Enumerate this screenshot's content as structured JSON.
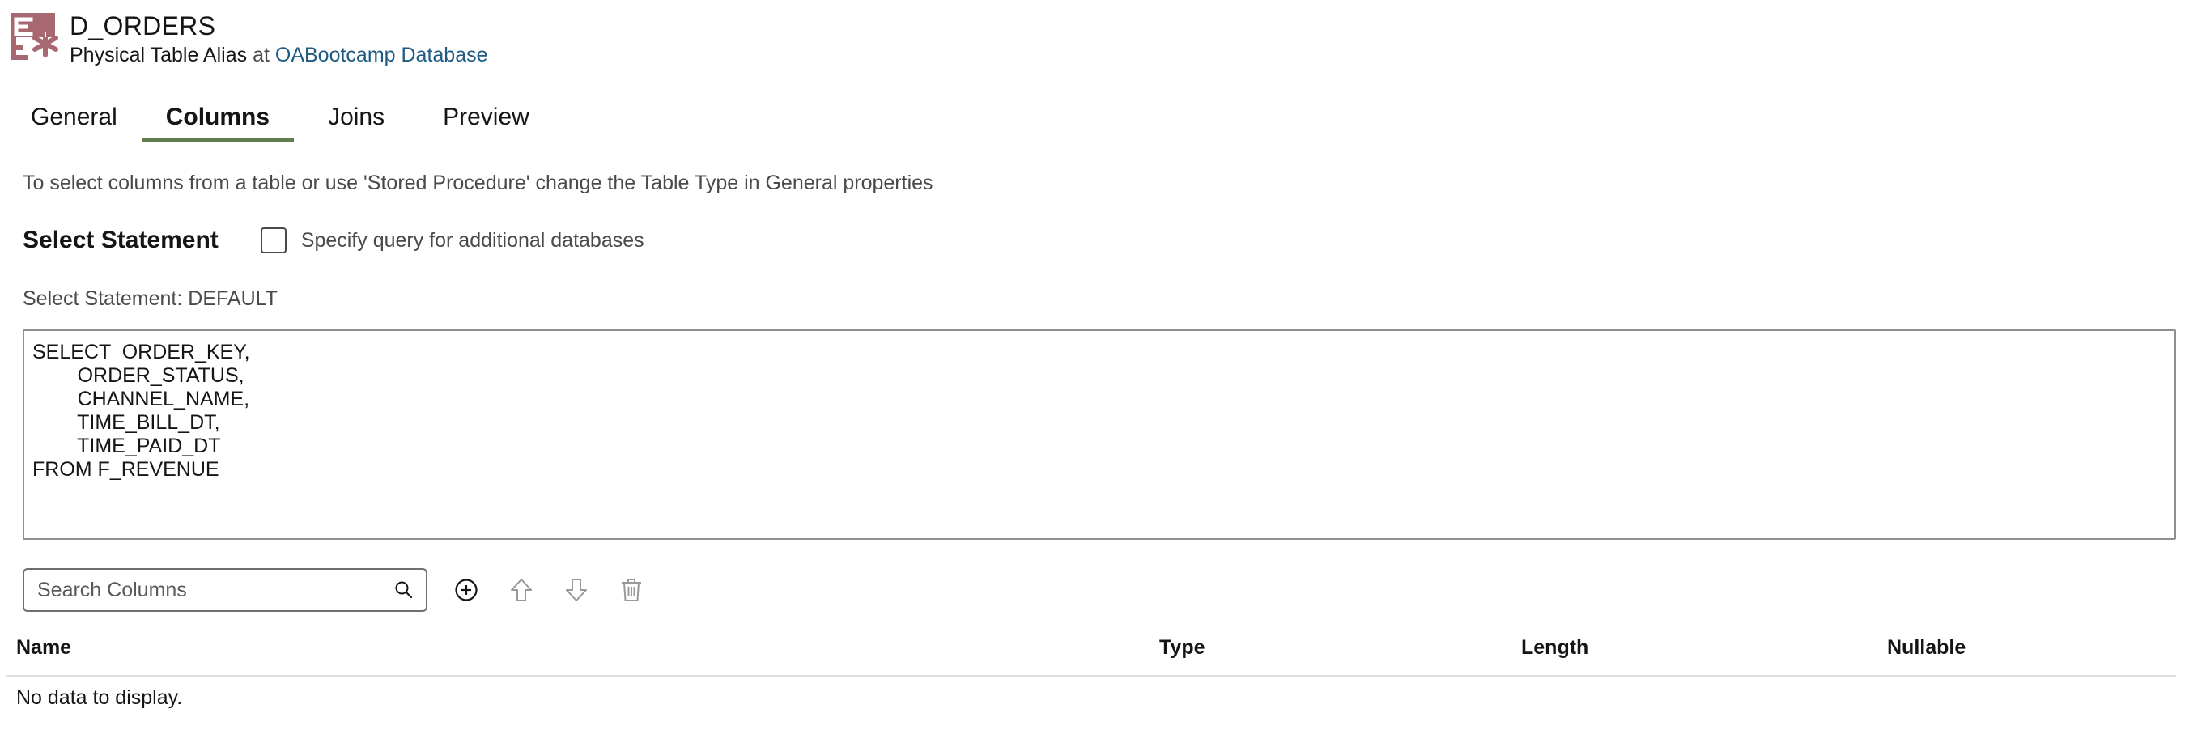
{
  "header": {
    "title": "D_ORDERS",
    "object_type": "Physical Table Alias",
    "at_word": "at",
    "database_link": "OABootcamp Database",
    "icon": "physical-table-alias-icon",
    "icon_color": "#a86872"
  },
  "tabs": [
    {
      "label": "General",
      "active": false
    },
    {
      "label": "Columns",
      "active": true
    },
    {
      "label": "Joins",
      "active": false
    },
    {
      "label": "Preview",
      "active": false
    }
  ],
  "accent_color": "#5f7d4f",
  "link_color": "#1e5a82",
  "info_text": "To select columns from a table or use 'Stored Procedure' change the Table Type in General properties",
  "select_section": {
    "heading": "Select Statement",
    "checkbox_label": "Specify query for additional databases",
    "checkbox_checked": false,
    "statement_label": "Select Statement: DEFAULT",
    "sql": "SELECT  ORDER_KEY,\n        ORDER_STATUS,\n        CHANNEL_NAME,\n        TIME_BILL_DT,\n        TIME_PAID_DT\nFROM F_REVENUE"
  },
  "toolbar": {
    "search_placeholder": "Search Columns",
    "search_value": "",
    "buttons": [
      "add-icon",
      "move-up-icon",
      "move-down-icon",
      "delete-icon"
    ]
  },
  "table": {
    "columns": [
      "Name",
      "Type",
      "Length",
      "Nullable"
    ],
    "rows": [],
    "empty_message": "No data to display."
  }
}
